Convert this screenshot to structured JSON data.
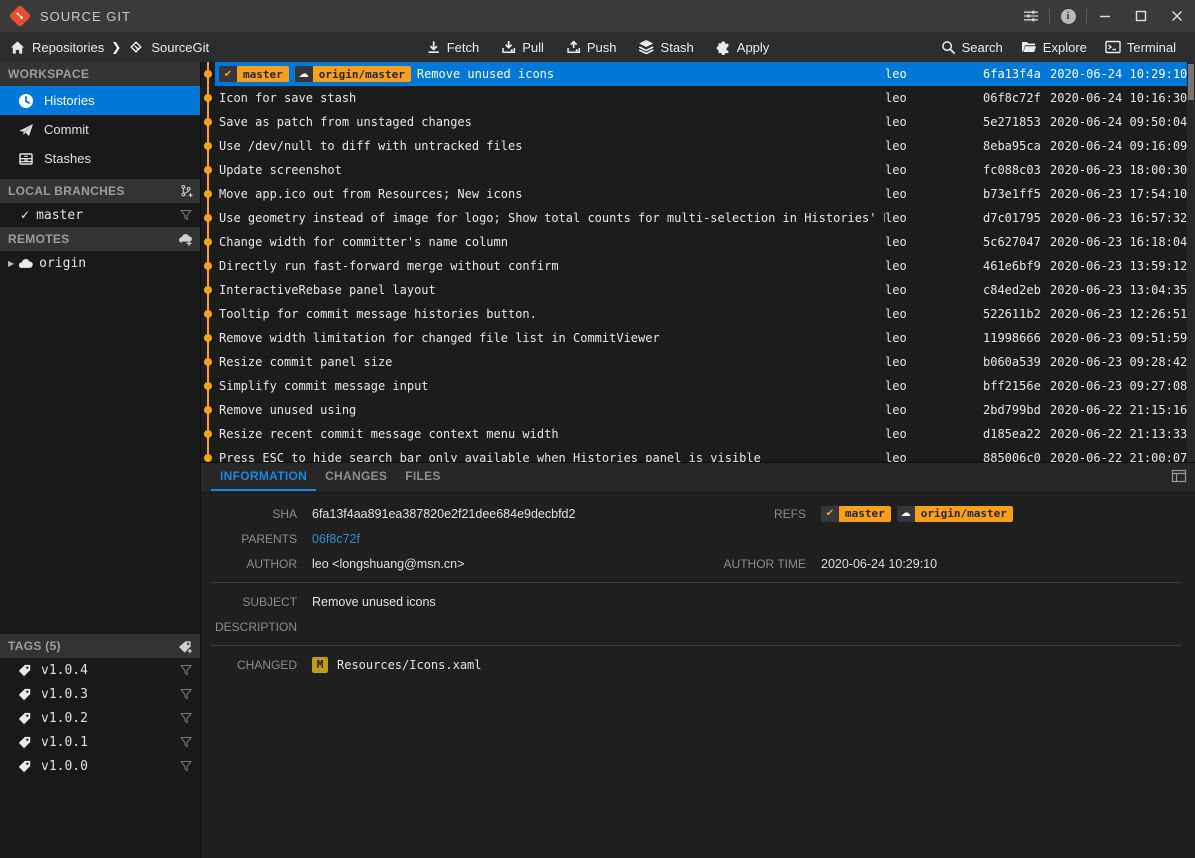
{
  "titlebar": {
    "app_title": "SOURCE GIT",
    "icons": [
      "app-logo-icon",
      "preferences-icon",
      "about-icon",
      "minimize-icon",
      "maximize-icon",
      "close-icon"
    ]
  },
  "toolbar": {
    "breadcrumb": {
      "repositories": "Repositories",
      "repo": "SourceGit"
    },
    "actions": [
      {
        "label": "Fetch",
        "icon": "fetch-icon"
      },
      {
        "label": "Pull",
        "icon": "pull-icon"
      },
      {
        "label": "Push",
        "icon": "push-icon"
      },
      {
        "label": "Stash",
        "icon": "stash-icon"
      },
      {
        "label": "Apply",
        "icon": "apply-icon"
      }
    ],
    "tools": [
      {
        "label": "Search",
        "icon": "search-icon"
      },
      {
        "label": "Explore",
        "icon": "explore-icon"
      },
      {
        "label": "Terminal",
        "icon": "terminal-icon"
      }
    ]
  },
  "sidebar": {
    "workspace": {
      "label": "WORKSPACE",
      "items": [
        {
          "label": "Histories",
          "icon": "clock-icon",
          "active": true
        },
        {
          "label": "Commit",
          "icon": "send-icon",
          "active": false
        },
        {
          "label": "Stashes",
          "icon": "stash-box-icon",
          "active": false
        }
      ]
    },
    "local_branches": {
      "label": "LOCAL BRANCHES",
      "header_icon": "add-branch-icon",
      "items": [
        {
          "name": "master",
          "current": true
        }
      ]
    },
    "remotes": {
      "label": "REMOTES",
      "header_icon": "add-remote-icon",
      "items": [
        {
          "name": "origin",
          "icon": "cloud-icon"
        }
      ]
    },
    "tags": {
      "label": "TAGS (5)",
      "header_icon": "add-tag-icon",
      "items": [
        {
          "name": "v1.0.4"
        },
        {
          "name": "v1.0.3"
        },
        {
          "name": "v1.0.2"
        },
        {
          "name": "v1.0.1"
        },
        {
          "name": "v1.0.0"
        }
      ]
    }
  },
  "history": {
    "commits": [
      {
        "selected": true,
        "refs": [
          {
            "name": "master",
            "icon": "check"
          },
          {
            "name": "origin/master",
            "icon": "cloud"
          }
        ],
        "subject": "Remove unused icons",
        "author": "leo",
        "sha": "6fa13f4a",
        "time": "2020-06-24 10:29:10"
      },
      {
        "subject": "Icon for save stash",
        "author": "leo",
        "sha": "06f8c72f",
        "time": "2020-06-24 10:16:30"
      },
      {
        "subject": "Save as patch from unstaged changes",
        "author": "leo",
        "sha": "5e271853",
        "time": "2020-06-24 09:50:04"
      },
      {
        "subject": "Use /dev/null to diff with untracked files",
        "author": "leo",
        "sha": "8eba95ca",
        "time": "2020-06-24 09:16:09"
      },
      {
        "subject": "Update screenshot",
        "author": "leo",
        "sha": "fc088c03",
        "time": "2020-06-23 18:00:30"
      },
      {
        "subject": "Move app.ico out from Resources; New icons",
        "author": "leo",
        "sha": "b73e1ff5",
        "time": "2020-06-23 17:54:10"
      },
      {
        "subject": "Use geometry instead of image for logo; Show total counts for multi-selection in Histories' DataGrid",
        "author": "leo",
        "sha": "d7c01795",
        "time": "2020-06-23 16:57:32"
      },
      {
        "subject": "Change width for committer's name column",
        "author": "leo",
        "sha": "5c627047",
        "time": "2020-06-23 16:18:04"
      },
      {
        "subject": "Directly run fast-forward merge without confirm",
        "author": "leo",
        "sha": "461e6bf9",
        "time": "2020-06-23 13:59:12"
      },
      {
        "subject": "InteractiveRebase panel layout",
        "author": "leo",
        "sha": "c84ed2eb",
        "time": "2020-06-23 13:04:35"
      },
      {
        "subject": "Tooltip for commit message histories button.",
        "author": "leo",
        "sha": "522611b2",
        "time": "2020-06-23 12:26:51"
      },
      {
        "subject": "Remove width limitation for changed file list in CommitViewer",
        "author": "leo",
        "sha": "11998666",
        "time": "2020-06-23 09:51:59"
      },
      {
        "subject": "Resize commit panel size",
        "author": "leo",
        "sha": "b060a539",
        "time": "2020-06-23 09:28:42"
      },
      {
        "subject": "Simplify commit message input",
        "author": "leo",
        "sha": "bff2156e",
        "time": "2020-06-23 09:27:08"
      },
      {
        "subject": "Remove unused using",
        "author": "leo",
        "sha": "2bd799bd",
        "time": "2020-06-22 21:15:16"
      },
      {
        "subject": "Resize recent commit message context menu width",
        "author": "leo",
        "sha": "d185ea22",
        "time": "2020-06-22 21:13:33"
      },
      {
        "subject": "Press ESC to hide search bar only available when Histories panel is visible",
        "author": "leo",
        "sha": "885006c0",
        "time": "2020-06-22 21:00:07"
      }
    ]
  },
  "detail": {
    "tabs": [
      {
        "label": "INFORMATION",
        "active": true
      },
      {
        "label": "CHANGES",
        "active": false
      },
      {
        "label": "FILES",
        "active": false
      }
    ],
    "sha_label": "SHA",
    "sha": "6fa13f4aa891ea387820e2f21dee684e9decbfd2",
    "refs_label": "REFS",
    "refs": [
      {
        "name": "master",
        "icon": "check"
      },
      {
        "name": "origin/master",
        "icon": "cloud"
      }
    ],
    "parents_label": "PARENTS",
    "parent": "06f8c72f",
    "author_label": "AUTHOR",
    "author": "leo <longshuang@msn.cn>",
    "author_time_label": "AUTHOR TIME",
    "author_time": "2020-06-24 10:29:10",
    "subject_label": "SUBJECT",
    "subject": "Remove unused icons",
    "description_label": "DESCRIPTION",
    "description": "",
    "changed_label": "CHANGED",
    "changed": [
      {
        "status": "M",
        "path": "Resources/Icons.xaml"
      }
    ]
  },
  "colors": {
    "accent_blue": "#0078d7",
    "graph_orange": "#f5a31d",
    "badge_orange": "#f9a01b",
    "link_blue": "#2e8fd7",
    "modified_badge": "#c09a1c"
  }
}
